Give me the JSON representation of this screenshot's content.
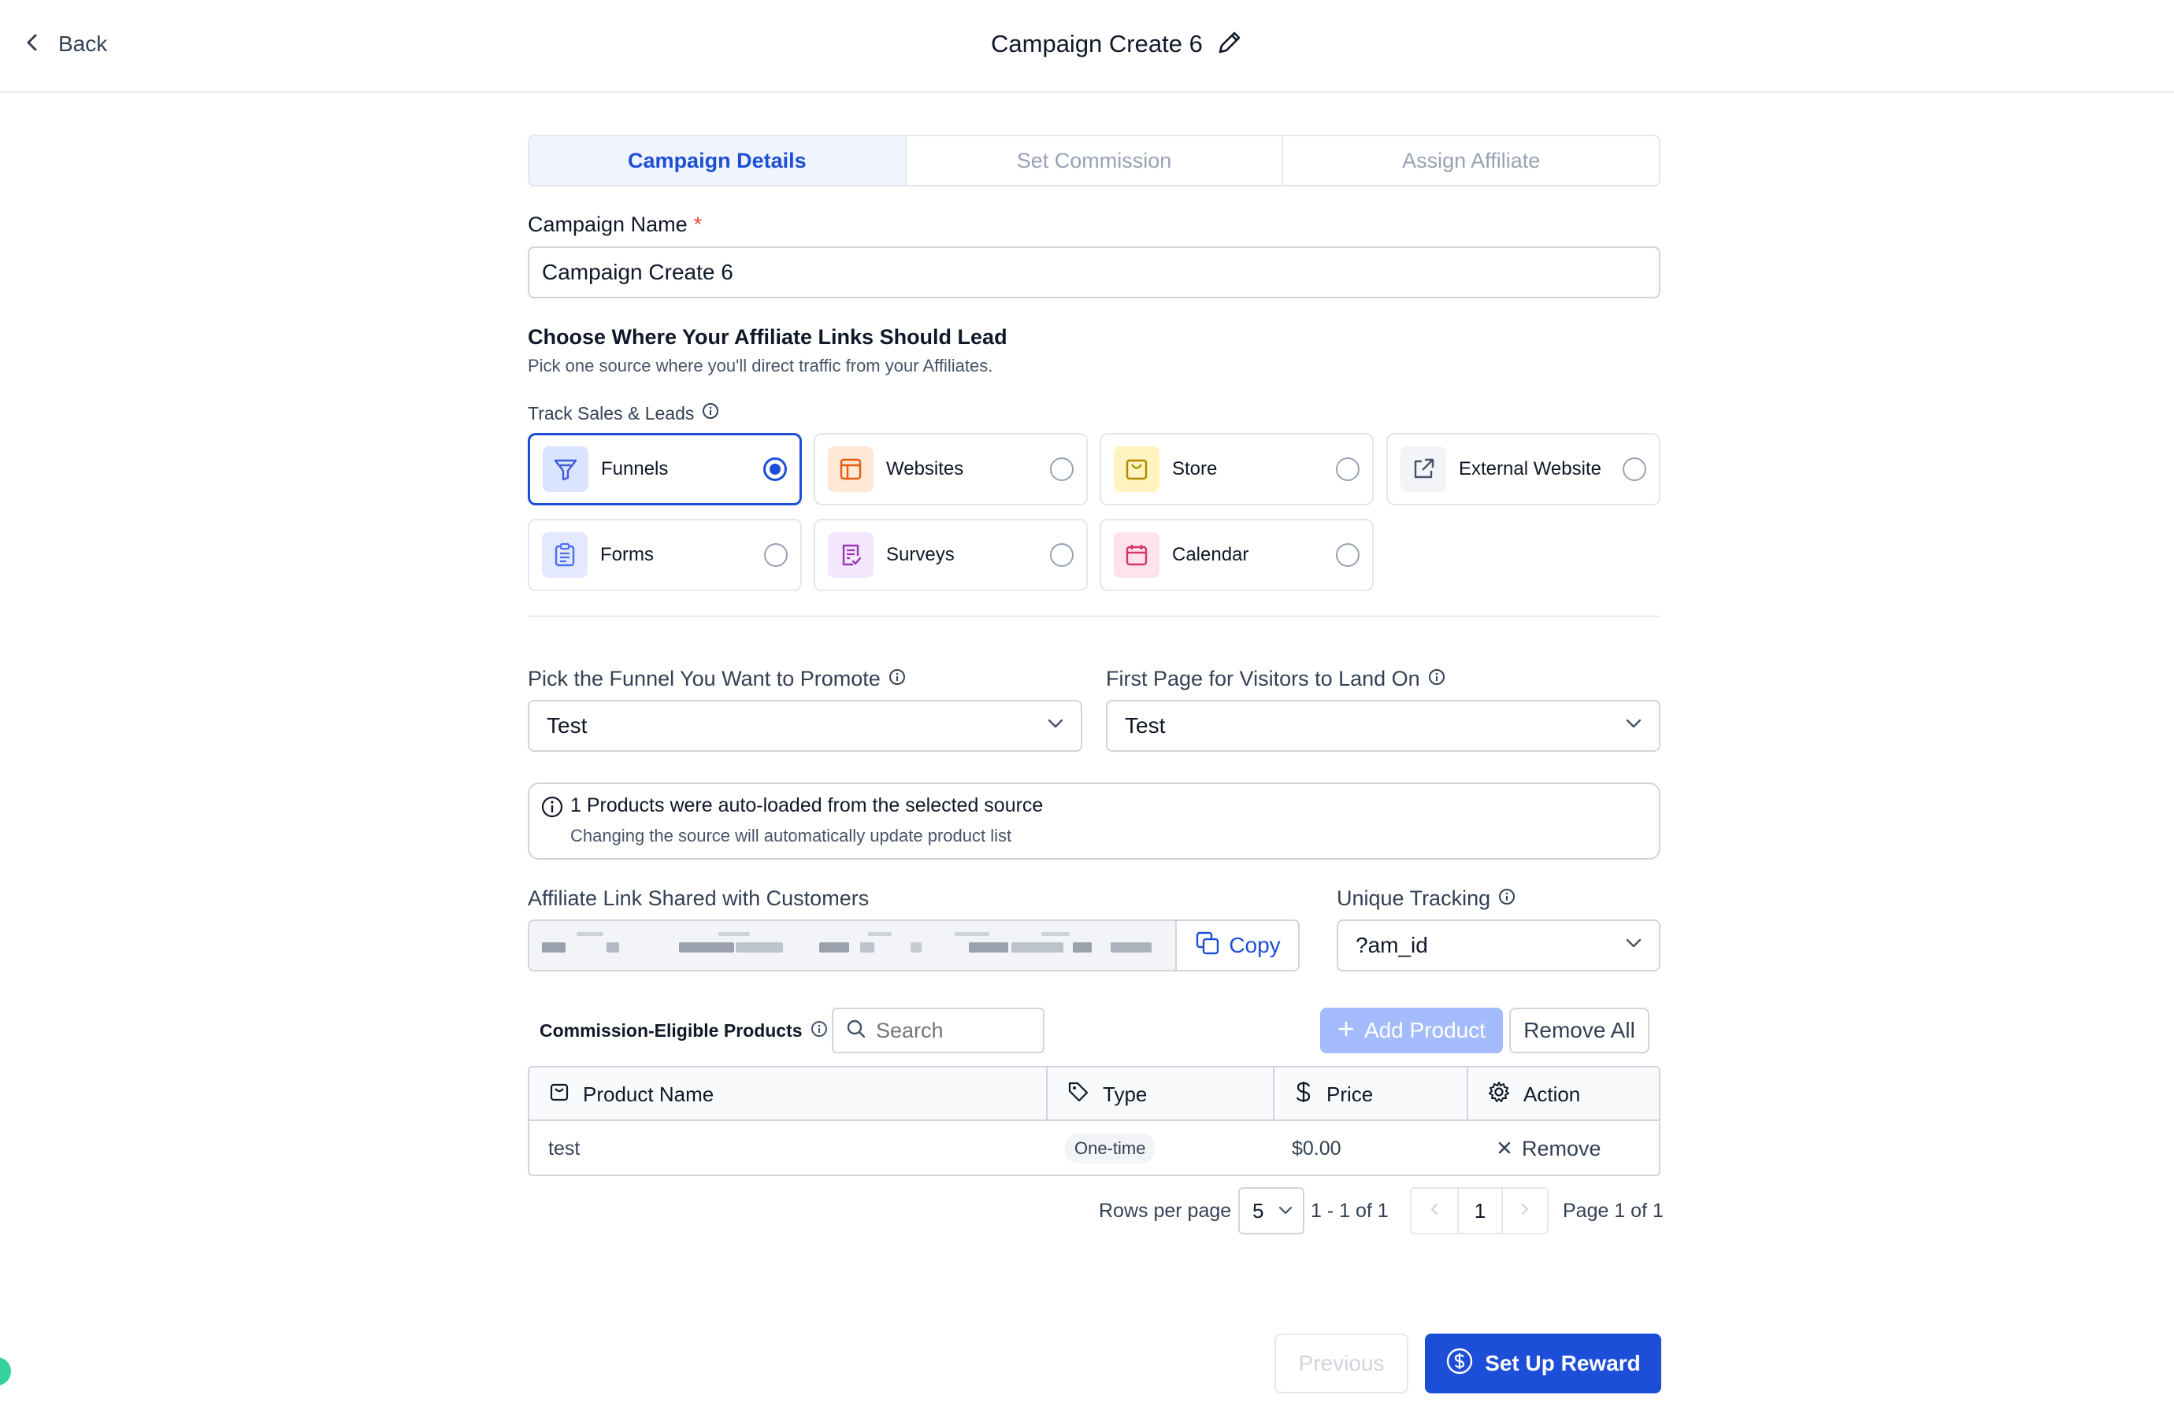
{
  "header": {
    "back_label": "Back",
    "title": "Campaign Create 6"
  },
  "tabs": [
    {
      "label": "Campaign Details",
      "active": true
    },
    {
      "label": "Set Commission",
      "active": false
    },
    {
      "label": "Assign Affiliate",
      "active": false
    }
  ],
  "campaign_name": {
    "label": "Campaign Name",
    "required_mark": "*",
    "value": "Campaign Create 6"
  },
  "destination": {
    "heading": "Choose Where Your Affiliate Links Should Lead",
    "subheading": "Pick one source where you'll direct traffic from your Affiliates.",
    "track_label": "Track Sales & Leads",
    "options": [
      {
        "label": "Funnels",
        "icon": "funnel-icon",
        "selected": true,
        "color": "#3b5bdb",
        "bg": "#dbe4ff"
      },
      {
        "label": "Websites",
        "icon": "layout-icon",
        "selected": false,
        "color": "#e8590c",
        "bg": "#ffe8d6"
      },
      {
        "label": "Store",
        "icon": "shopping-bag-icon",
        "selected": false,
        "color": "#b08900",
        "bg": "#fff3bf"
      },
      {
        "label": "External Website",
        "icon": "external-link-icon",
        "selected": false,
        "color": "#475467",
        "bg": "#f2f4f7"
      },
      {
        "label": "Forms",
        "icon": "clipboard-icon",
        "selected": false,
        "color": "#4c6ef5",
        "bg": "#e5e9ff"
      },
      {
        "label": "Surveys",
        "icon": "survey-icon",
        "selected": false,
        "color": "#9c36b5",
        "bg": "#f3e8ff"
      },
      {
        "label": "Calendar",
        "icon": "calendar-icon",
        "selected": false,
        "color": "#d6336c",
        "bg": "#ffe3ec"
      }
    ]
  },
  "funnel_select": {
    "label": "Pick the Funnel You Want to Promote",
    "value": "Test"
  },
  "landing_select": {
    "label": "First Page for Visitors to Land On",
    "value": "Test"
  },
  "notice": {
    "title": "1 Products were auto-loaded from the selected source",
    "detail": "Changing the source will automatically update product list"
  },
  "affiliate_link": {
    "label": "Affiliate Link Shared with Customers",
    "copy_label": "Copy"
  },
  "unique_tracking": {
    "label": "Unique Tracking",
    "value": "?am_id"
  },
  "products": {
    "label": "Commission-Eligible Products",
    "search_placeholder": "Search",
    "add_label": "Add Product",
    "remove_all_label": "Remove All",
    "columns": [
      "Product Name",
      "Type",
      "Price",
      "Action"
    ],
    "rows": [
      {
        "name": "test",
        "type": "One-time",
        "price": "$0.00",
        "action": "Remove"
      }
    ]
  },
  "pagination": {
    "rows_per_page_label": "Rows per page",
    "rows_per_page": "5",
    "range": "1 - 1 of 1",
    "current_page": "1",
    "page_info": "Page 1 of 1"
  },
  "footer": {
    "previous_label": "Previous",
    "next_label": "Set Up Reward"
  },
  "colors": {
    "primary": "#1d4ed8",
    "primary_disabled": "#a4bcfd",
    "active_tab_bg": "#eff4ff",
    "border": "#d0d5dd"
  }
}
